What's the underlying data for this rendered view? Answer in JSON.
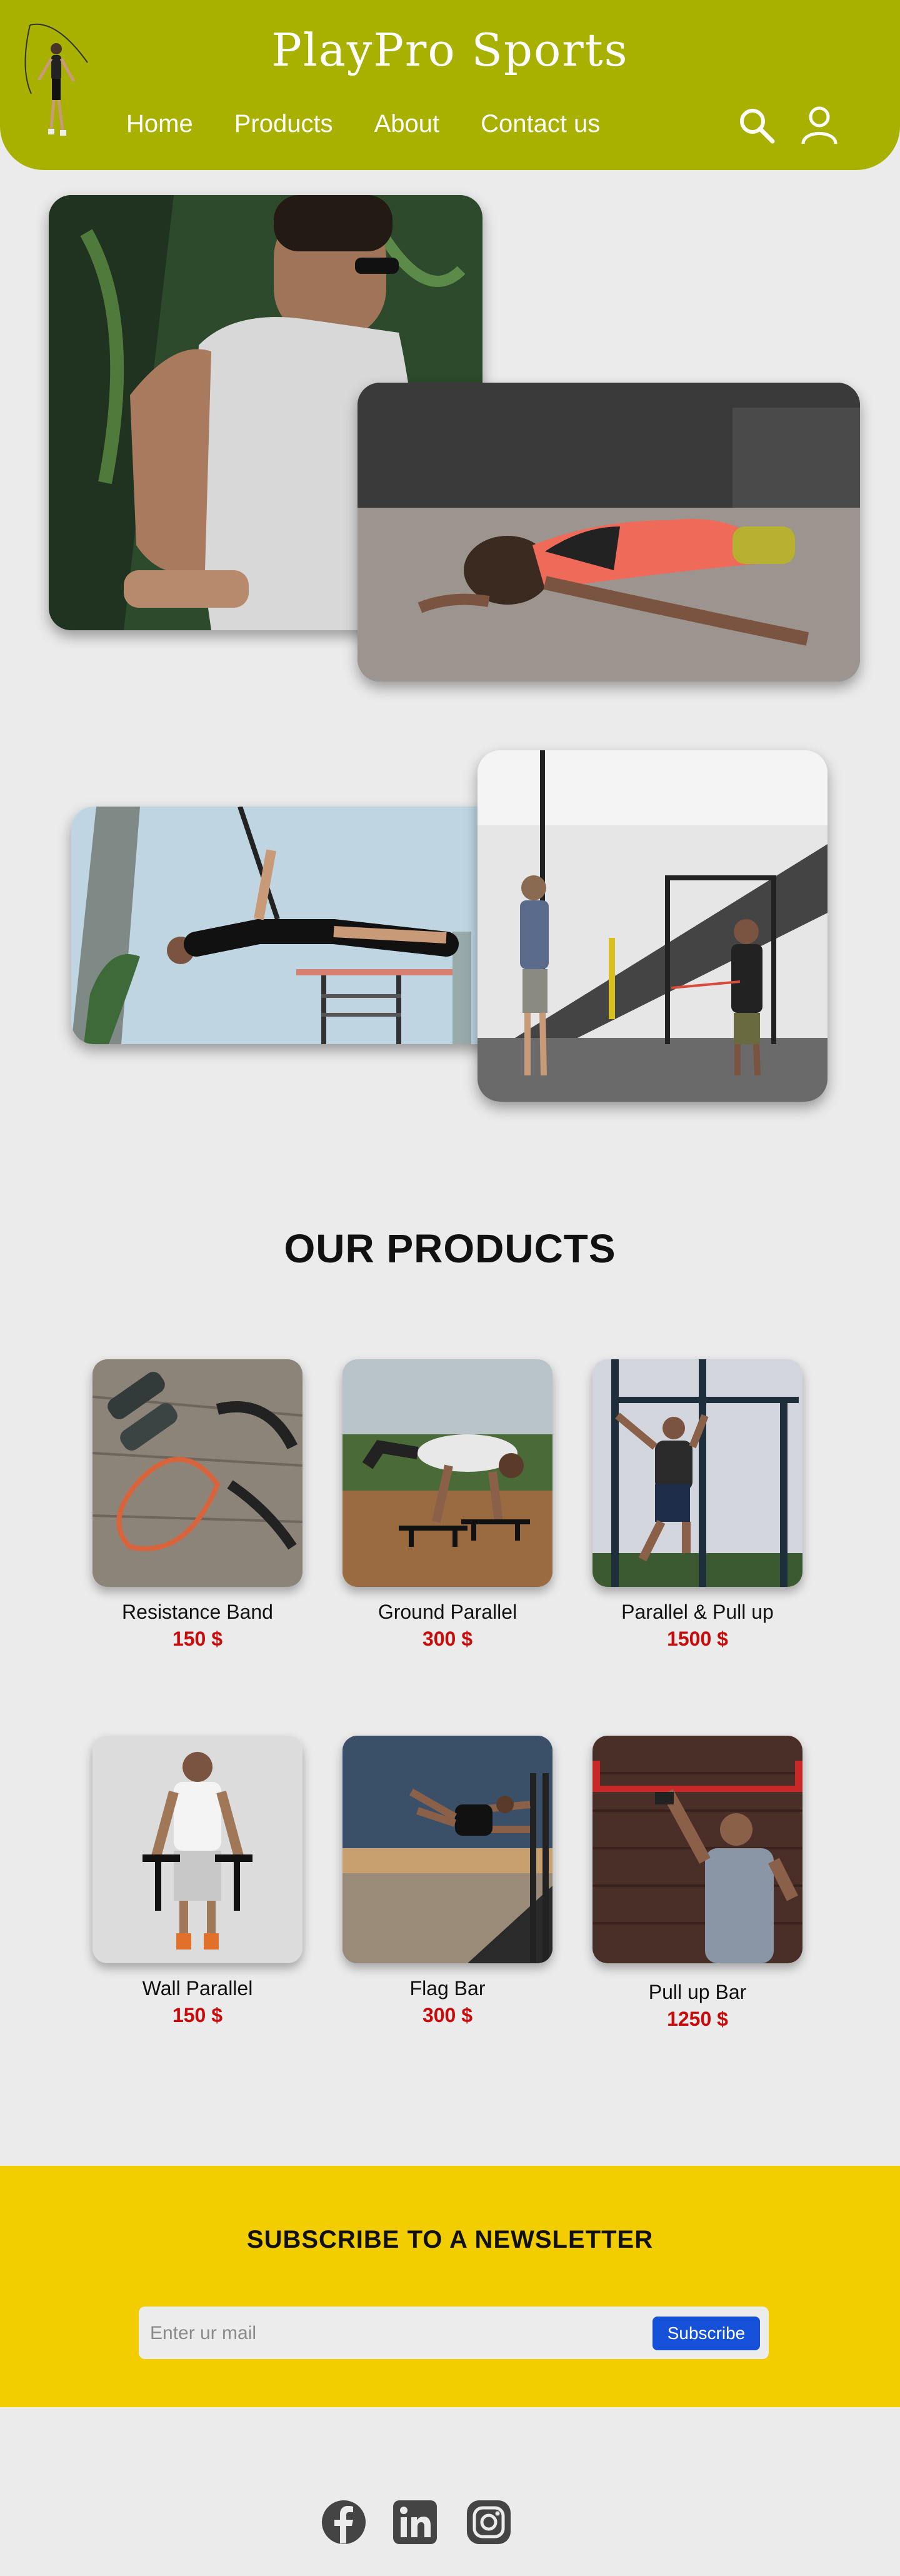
{
  "header": {
    "brand": "PlayPro Sports",
    "nav": [
      "Home",
      "Products",
      "About",
      "Contact us"
    ],
    "icons": [
      "search-icon",
      "user-icon"
    ]
  },
  "hero_images": [
    "man-tank-top-photo",
    "man-stretching-photo",
    "man-bar-flag-photo",
    "trainer-gym-photo"
  ],
  "products_section": {
    "title": "OUR PRODUCTS",
    "items": [
      {
        "name": "Resistance Band",
        "price": "150 $"
      },
      {
        "name": "Ground Parallel",
        "price": "300 $"
      },
      {
        "name": "Parallel & Pull up",
        "price": "1500 $"
      },
      {
        "name": "Wall Parallel",
        "price": "150 $"
      },
      {
        "name": "Flag Bar",
        "price": "300 $"
      },
      {
        "name": "Pull up Bar",
        "price": "1250 $"
      }
    ]
  },
  "newsletter": {
    "title": "SUBSCRIBE TO A NEWSLETTER",
    "placeholder": "Enter ur mail",
    "button": "Subscribe"
  },
  "footer": {
    "social_icons": [
      "facebook-icon",
      "linkedin-icon",
      "instagram-icon"
    ]
  },
  "colors": {
    "header": "#a8b000",
    "newsletter_bg": "#f2cd00",
    "price": "#c80a0a",
    "subscribe_button": "#1450d8",
    "page_bg": "#ebebeb"
  }
}
